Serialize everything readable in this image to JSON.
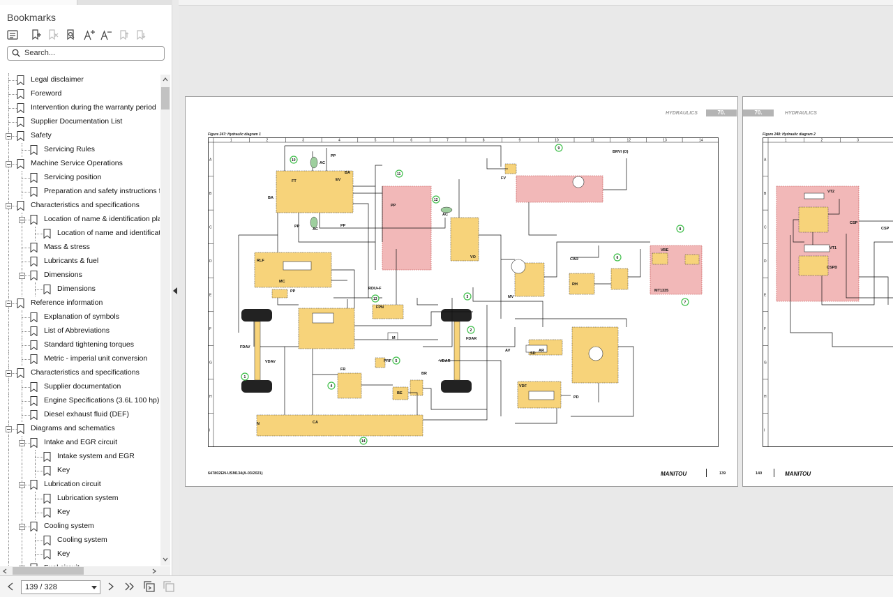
{
  "panel": {
    "title": "Bookmarks",
    "search_placeholder": "Search..."
  },
  "toolbar_icons": [
    "bookmarks-list-icon",
    "add-bookmark-icon",
    "delete-bookmark-icon",
    "find-bookmark-icon",
    "increase-text-icon",
    "decrease-text-icon",
    "move-bookmark-up-icon",
    "move-bookmark-down-icon"
  ],
  "bookmarks": [
    {
      "label": "Legal disclaimer",
      "level": 0,
      "toggle": "none"
    },
    {
      "label": "Foreword",
      "level": 0,
      "toggle": "none"
    },
    {
      "label": "Intervention during the warranty period",
      "level": 0,
      "toggle": "none"
    },
    {
      "label": "Supplier Documentation List",
      "level": 0,
      "toggle": "none"
    },
    {
      "label": "Safety",
      "level": 0,
      "toggle": "minus"
    },
    {
      "label": "Servicing Rules",
      "level": 1,
      "toggle": "none"
    },
    {
      "label": "Machine Service Operations",
      "level": 0,
      "toggle": "minus"
    },
    {
      "label": "Servicing position",
      "level": 1,
      "toggle": "none"
    },
    {
      "label": "Preparation and safety instructions for",
      "level": 1,
      "toggle": "none"
    },
    {
      "label": "Characteristics and specifications",
      "level": 0,
      "toggle": "minus"
    },
    {
      "label": "Location of name & identification plat",
      "level": 1,
      "toggle": "minus"
    },
    {
      "label": "Location of name and identificati",
      "level": 2,
      "toggle": "none"
    },
    {
      "label": "Mass & stress",
      "level": 1,
      "toggle": "none"
    },
    {
      "label": "Lubricants & fuel",
      "level": 1,
      "toggle": "none"
    },
    {
      "label": "Dimensions",
      "level": 1,
      "toggle": "minus"
    },
    {
      "label": "Dimensions",
      "level": 2,
      "toggle": "none"
    },
    {
      "label": "Reference information",
      "level": 0,
      "toggle": "minus"
    },
    {
      "label": "Explanation of symbols",
      "level": 1,
      "toggle": "none"
    },
    {
      "label": "List of Abbreviations",
      "level": 1,
      "toggle": "none"
    },
    {
      "label": "Standard tightening torques",
      "level": 1,
      "toggle": "none"
    },
    {
      "label": "Metric - imperial unit conversion",
      "level": 1,
      "toggle": "none"
    },
    {
      "label": "Characteristics and specifications",
      "level": 0,
      "toggle": "minus"
    },
    {
      "label": "Supplier documentation",
      "level": 1,
      "toggle": "none"
    },
    {
      "label": "Engine Specifications (3.6L 100 hp)",
      "level": 1,
      "toggle": "none"
    },
    {
      "label": "Diesel exhaust fluid (DEF)",
      "level": 1,
      "toggle": "none"
    },
    {
      "label": "Diagrams and schematics",
      "level": 0,
      "toggle": "minus"
    },
    {
      "label": "Intake and EGR circuit",
      "level": 1,
      "toggle": "minus"
    },
    {
      "label": "Intake system and EGR",
      "level": 2,
      "toggle": "none"
    },
    {
      "label": "Key",
      "level": 2,
      "toggle": "none"
    },
    {
      "label": "Lubrication circuit",
      "level": 1,
      "toggle": "minus"
    },
    {
      "label": "Lubrication system",
      "level": 2,
      "toggle": "none"
    },
    {
      "label": "Key",
      "level": 2,
      "toggle": "none"
    },
    {
      "label": "Cooling system",
      "level": 1,
      "toggle": "minus"
    },
    {
      "label": "Cooling system",
      "level": 2,
      "toggle": "none"
    },
    {
      "label": "Key",
      "level": 2,
      "toggle": "none"
    },
    {
      "label": "Fuel circuit",
      "level": 1,
      "toggle": "minus"
    }
  ],
  "page_left": {
    "header_label": "HYDRAULICS",
    "header_number": "70.",
    "figure_caption": "Figure 247: Hydraulic diagram 1",
    "footer_doc": "647802EN-USM134(A-03/2021)",
    "brand": "MANITOU",
    "page_number": "139",
    "column_numbers": [
      "1",
      "2",
      "3",
      "4",
      "5",
      "6",
      "7",
      "8",
      "9",
      "10",
      "11",
      "12",
      "13",
      "14"
    ],
    "row_letters": [
      "A",
      "B",
      "C",
      "D",
      "E",
      "F",
      "G",
      "H",
      "I"
    ],
    "component_labels": [
      "BA",
      "AC",
      "PP",
      "EV",
      "BA",
      "FT",
      "PP",
      "AC",
      "PP",
      "RLF",
      "MC",
      "PP",
      "RDU+F",
      "FPN",
      "PP",
      "AC",
      "VO",
      "FV",
      "BRVI (O)",
      "CAR",
      "RH",
      "MV",
      "VBE",
      "MT1335",
      "FDAV",
      "VDAV",
      "FR",
      "PRF",
      "BE",
      "BR",
      "CA",
      "N",
      "M",
      "FDAR",
      "VDAR",
      "AV",
      "AR",
      "SD",
      "VDF",
      "PD"
    ],
    "callout_numbers": [
      "1",
      "2",
      "3",
      "4",
      "5",
      "6",
      "7",
      "8",
      "9",
      "10",
      "11",
      "12",
      "13",
      "14"
    ]
  },
  "page_right": {
    "header_label": "HYDRAULICS",
    "header_number": "70.",
    "figure_caption": "Figure 248: Hydraulic diagram 2",
    "brand": "MANITOU",
    "page_number": "140",
    "column_numbers": [
      "1",
      "2",
      "3"
    ],
    "row_letters": [
      "A",
      "B",
      "C",
      "D",
      "E",
      "F",
      "G",
      "H",
      "I"
    ],
    "component_labels": [
      "VT2",
      "CSP",
      "CSP",
      "VT1",
      "CSPD"
    ]
  },
  "navigation": {
    "page_indicator": "139 / 328"
  },
  "colors": {
    "component_fill": "#f7d37a",
    "zone_fill": "#f2b8b8",
    "callout_green": "#3fbf4a",
    "header_gray": "#b4b4b4"
  }
}
